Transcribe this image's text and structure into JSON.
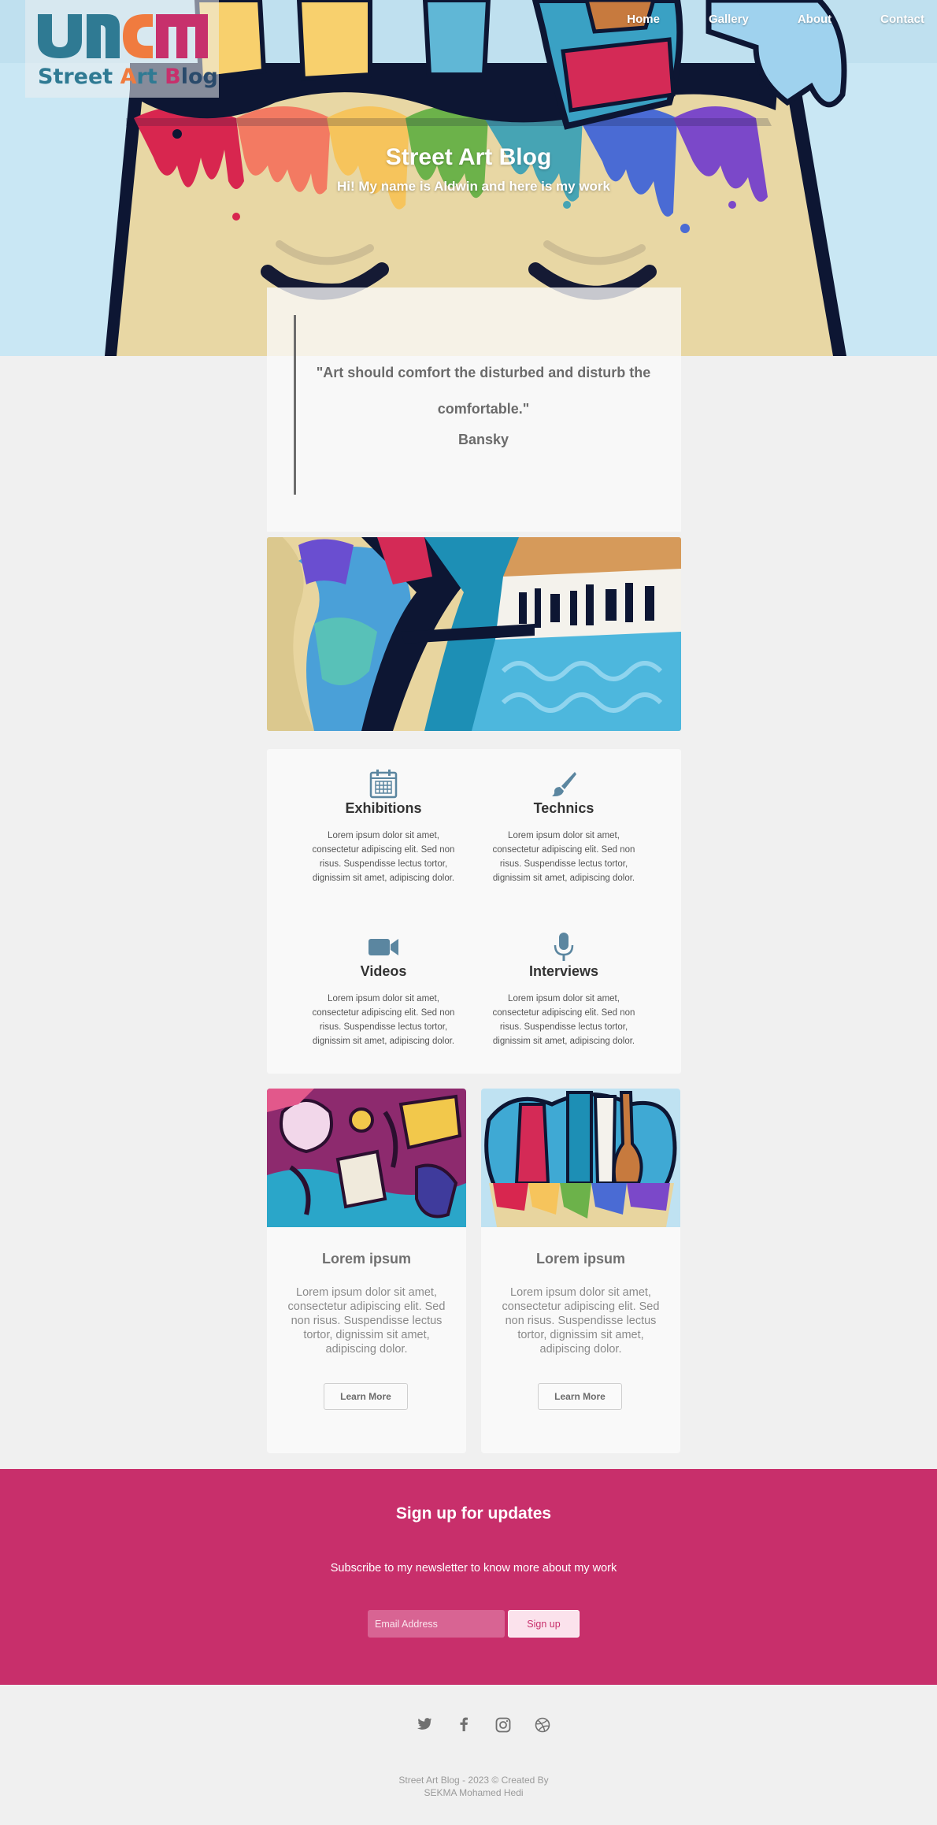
{
  "logo": {
    "text_parts": [
      "Street ",
      "A",
      "rt ",
      "B",
      "log"
    ],
    "alt": "Street Art Blog logo"
  },
  "nav": {
    "items": [
      "Home",
      "Gallery",
      "About",
      "Contact"
    ]
  },
  "hero": {
    "title": "Street Art Blog",
    "subtitle": "Hi! My name is Aldwin and here is my work"
  },
  "quote": {
    "text": "\"Art should comfort the disturbed and disturb the comfortable.\"",
    "author": "Bansky"
  },
  "features": [
    {
      "icon": "calendar-icon",
      "title": "Exhibitions",
      "text": "Lorem ipsum dolor sit amet, consectetur adipiscing elit. Sed non risus. Suspendisse lectus tortor, dignissim sit amet, adipiscing dolor."
    },
    {
      "icon": "brush-icon",
      "title": "Technics",
      "text": "Lorem ipsum dolor sit amet, consectetur adipiscing elit. Sed non risus. Suspendisse lectus tortor, dignissim sit amet, adipiscing dolor."
    },
    {
      "icon": "video-camera-icon",
      "title": "Videos",
      "text": "Lorem ipsum dolor sit amet, consectetur adipiscing elit. Sed non risus. Suspendisse lectus tortor, dignissim sit amet, adipiscing dolor."
    },
    {
      "icon": "microphone-icon",
      "title": "Interviews",
      "text": "Lorem ipsum dolor sit amet, consectetur adipiscing elit. Sed non risus. Suspendisse lectus tortor, dignissim sit amet, adipiscing dolor."
    }
  ],
  "cards": [
    {
      "title": "Lorem ipsum",
      "text": "Lorem ipsum dolor sit amet, consectetur adipiscing elit. Sed non risus. Suspendisse lectus tortor, dignissim sit amet, adipiscing dolor.",
      "button": "Learn More"
    },
    {
      "title": "Lorem ipsum",
      "text": "Lorem ipsum dolor sit amet, consectetur adipiscing elit. Sed non risus. Suspendisse lectus tortor, dignissim sit amet, adipiscing dolor.",
      "button": "Learn More"
    }
  ],
  "signup": {
    "title": "Sign up for updates",
    "subtitle": "Subscribe to my newsletter to know more about my work",
    "email_placeholder": "Email Address",
    "button": "Sign up"
  },
  "footer": {
    "socials": [
      "twitter-icon",
      "facebook-icon",
      "instagram-icon",
      "dribbble-icon"
    ],
    "line1": "Street Art Blog - 2023 © Created By",
    "line2": "SEKMA Mohamed Hedi"
  },
  "colors": {
    "accent_pink": "#c82f6b",
    "teal": "#2f7a93",
    "orange": "#f07b3f",
    "icon_blue": "#5b86a0"
  }
}
